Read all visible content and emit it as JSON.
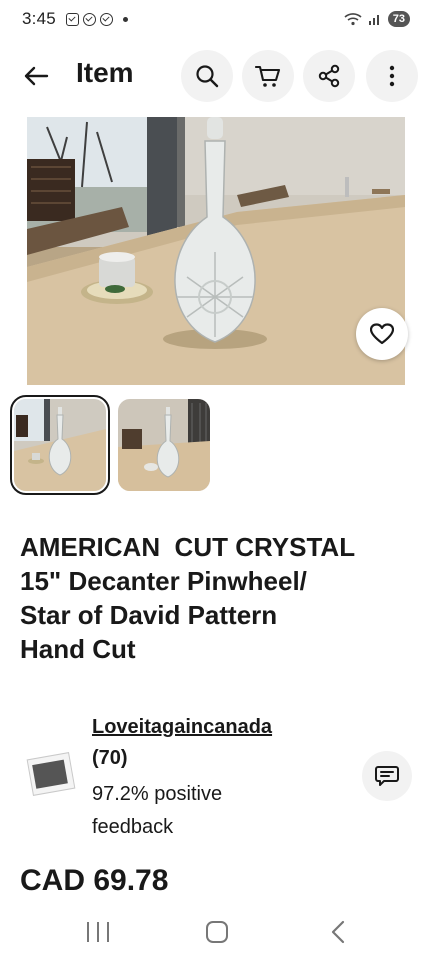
{
  "status_bar": {
    "time": "3:45",
    "battery": "73"
  },
  "header": {
    "title": "Item"
  },
  "item": {
    "title": "AMERICAN  CUT CRYSTAL\n15\" Decanter Pinwheel/\nStar of David Pattern\nHand Cut",
    "price": "CAD 69.78"
  },
  "seller": {
    "name": "Loveitagaincanada",
    "count": "(70)",
    "feedback": "97.2% positive feedback"
  },
  "colors": {
    "text": "#191919",
    "button_bg": "#f2f2f2",
    "table": "#d8c3a2"
  },
  "icons": {
    "back": "arrow-left-icon",
    "search": "search-icon",
    "cart": "cart-icon",
    "share": "share-icon",
    "more": "more-vertical-icon",
    "favorite": "heart-icon",
    "message": "message-icon"
  }
}
